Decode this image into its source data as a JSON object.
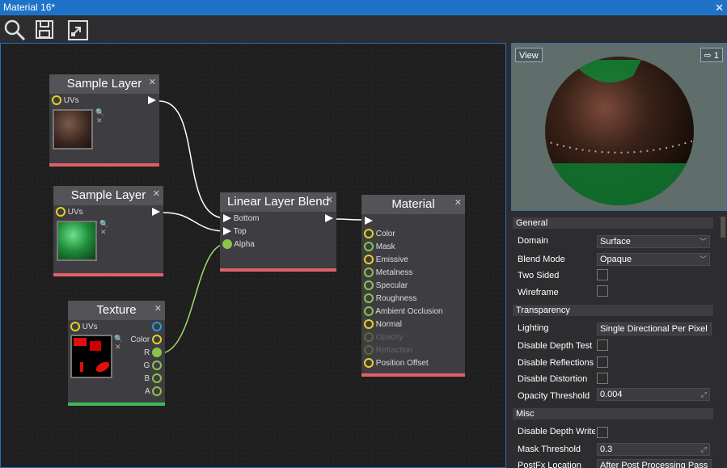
{
  "window": {
    "title": "Material 16*",
    "close": "✕"
  },
  "toolbar": {
    "search": "search-icon",
    "save": "save-icon",
    "reimport": "expand-icon"
  },
  "nodes": {
    "sample1": {
      "title": "Sample Layer",
      "uvs": "UVs",
      "close": "✕"
    },
    "sample2": {
      "title": "Sample Layer",
      "uvs": "UVs",
      "close": "✕"
    },
    "texture": {
      "title": "Texture",
      "uvs": "UVs",
      "color": "Color",
      "r": "R",
      "g": "G",
      "b": "B",
      "a": "A",
      "close": "✕"
    },
    "blend": {
      "title": "Linear Layer Blend",
      "bottom": "Bottom",
      "top": "Top",
      "alpha": "Alpha",
      "close": "✕"
    },
    "material": {
      "title": "Material",
      "close": "✕",
      "inputs": [
        "Color",
        "Mask",
        "Emissive",
        "Metalness",
        "Specular",
        "Roughness",
        "Ambient Occlusion",
        "Normal",
        "Opacity",
        "Refraction",
        "Position Offset"
      ]
    }
  },
  "preview": {
    "view_label": "View",
    "counter": "1"
  },
  "props": {
    "general": "General",
    "domain_label": "Domain",
    "domain_value": "Surface",
    "blend_label": "Blend Mode",
    "blend_value": "Opaque",
    "two_sided": "Two Sided",
    "wireframe": "Wireframe",
    "transparency": "Transparency",
    "lighting_label": "Lighting",
    "lighting_value": "Single Directional Per Pixel",
    "disable_depth_test": "Disable Depth Test",
    "disable_reflections": "Disable Reflections",
    "disable_distortion": "Disable Distortion",
    "opacity_threshold_label": "Opacity Threshold",
    "opacity_threshold_value": "0.004",
    "misc": "Misc",
    "disable_depth_write": "Disable Depth Write",
    "mask_threshold_label": "Mask Threshold",
    "mask_threshold_value": "0.3",
    "postfx_label": "PostFx Location",
    "postfx_value": "After Post Processing Pass"
  },
  "colors": {
    "accent": "#1e73c9",
    "pink": "#e0606a",
    "green": "#3fb85a",
    "yellow": "#e8d020",
    "pin_green": "#8bc34a"
  }
}
